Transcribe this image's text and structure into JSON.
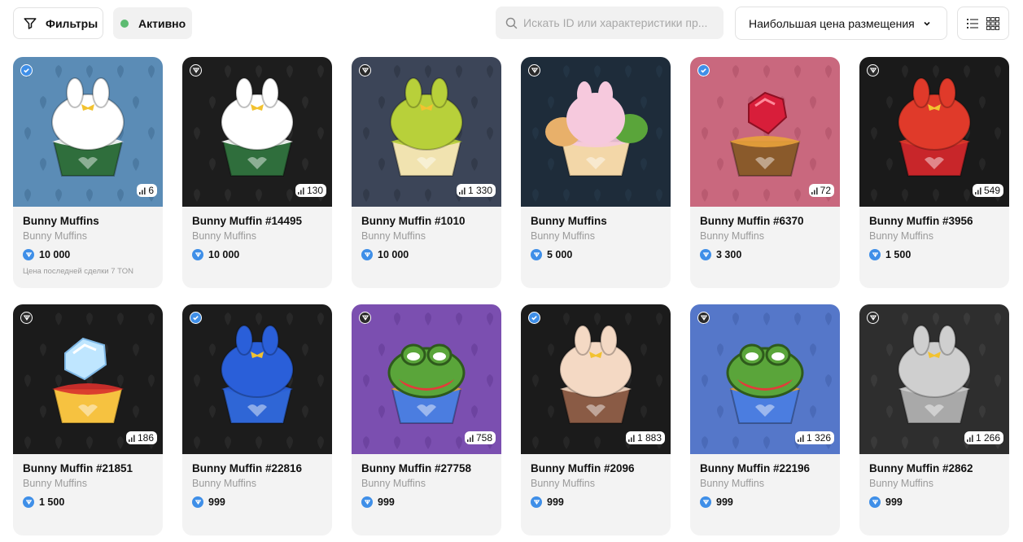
{
  "toolbar": {
    "filters_label": "Фильтры",
    "status_label": "Активно",
    "status_color": "#5dbb71",
    "search_placeholder": "Искать ID или характеристики пр...",
    "sort_label": "Наибольшая цена размещения",
    "view_icons": [
      "list-view-icon",
      "grid-view-icon"
    ]
  },
  "items": [
    {
      "name": "Bunny Muffins",
      "collection": "Bunny Muffins",
      "price": "10 000",
      "count": "6",
      "badge": "blue",
      "last_sale": "Цена последней сделки 7 TON",
      "bg": "#5b8cb6",
      "pattern": "#4c7aa2",
      "cake": "#ffffff",
      "cup": "#2f6e3c",
      "top": "bunny-white"
    },
    {
      "name": "Bunny Muffin #14495",
      "collection": "Bunny Muffins",
      "price": "10 000",
      "count": "130",
      "badge": "dark",
      "last_sale": "",
      "bg": "#1d1d1d",
      "pattern": "#2a2a2a",
      "cake": "#ffffff",
      "cup": "#2f6e3c",
      "top": "bunny-white"
    },
    {
      "name": "Bunny Muffin #1010",
      "collection": "Bunny Muffins",
      "price": "10 000",
      "count": "1 330",
      "badge": "dark",
      "last_sale": "",
      "bg": "#3c4558",
      "pattern": "#323a4a",
      "cake": "#b8d03a",
      "cup": "#f1e3b0",
      "top": "bunny-green"
    },
    {
      "name": "Bunny Muffins",
      "collection": "Bunny Muffins",
      "price": "5 000",
      "count": "",
      "badge": "dark",
      "last_sale": "",
      "bg": "#1e2c3a",
      "pattern": "#233444",
      "cake": "#f6c9dd",
      "cup": "#f3d7a8",
      "top": "trio"
    },
    {
      "name": "Bunny Muffin #6370",
      "collection": "Bunny Muffins",
      "price": "3 300",
      "count": "72",
      "badge": "blue",
      "last_sale": "",
      "bg": "#c9687e",
      "pattern": "#b95a70",
      "cake": "#e9a23b",
      "cup": "#8a5a2b",
      "top": "ruby"
    },
    {
      "name": "Bunny Muffin #3956",
      "collection": "Bunny Muffins",
      "price": "1 500",
      "count": "549",
      "badge": "dark",
      "last_sale": "",
      "bg": "#1a1a1a",
      "pattern": "#262626",
      "cake": "#e03a2a",
      "cup": "#c8262a",
      "top": "bunny-red"
    },
    {
      "name": "Bunny Muffin #21851",
      "collection": "Bunny Muffins",
      "price": "1 500",
      "count": "186",
      "badge": "dark",
      "last_sale": "",
      "bg": "#1b1b1b",
      "pattern": "#272727",
      "cake": "#d8302c",
      "cup": "#f6c240",
      "top": "diamond"
    },
    {
      "name": "Bunny Muffin #22816",
      "collection": "Bunny Muffins",
      "price": "999",
      "count": "",
      "badge": "blue",
      "last_sale": "",
      "bg": "#1c1c1c",
      "pattern": "#282828",
      "cake": "#2a5fd9",
      "cup": "#2f66d6",
      "top": "bunny-blue"
    },
    {
      "name": "Bunny Muffin #27758",
      "collection": "Bunny Muffins",
      "price": "999",
      "count": "758",
      "badge": "dark",
      "last_sale": "",
      "bg": "#7b4fb0",
      "pattern": "#6d43a0",
      "cake": "#e9a23b",
      "cup": "#4b7de0",
      "top": "frog"
    },
    {
      "name": "Bunny Muffin #2096",
      "collection": "Bunny Muffins",
      "price": "999",
      "count": "1 883",
      "badge": "blue",
      "last_sale": "",
      "bg": "#1b1b1b",
      "pattern": "#262626",
      "cake": "#f4d9c4",
      "cup": "#8a5b45",
      "top": "bunny-cream"
    },
    {
      "name": "Bunny Muffin #22196",
      "collection": "Bunny Muffins",
      "price": "999",
      "count": "1 326",
      "badge": "dark",
      "last_sale": "",
      "bg": "#5577c9",
      "pattern": "#4a6ab8",
      "cake": "#e9a23b",
      "cup": "#4b7de0",
      "top": "frog"
    },
    {
      "name": "Bunny Muffin #2862",
      "collection": "Bunny Muffins",
      "price": "999",
      "count": "1 266",
      "badge": "dark",
      "last_sale": "",
      "bg": "#2e2e2e",
      "pattern": "#3a3a3a",
      "cake": "#cfcfcf",
      "cup": "#a9a9a9",
      "top": "bunny-silver"
    }
  ]
}
